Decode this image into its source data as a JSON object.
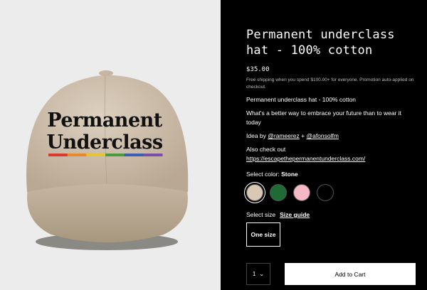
{
  "product": {
    "title_line1": "Permanent underclass",
    "title_line2": "hat - 100% cotton",
    "price": "$35.00",
    "shipping_note": "Free shipping when you spend $100.00+ for everyone. Promotion auto-applied on checkout.",
    "description_line": "Permanent underclass hat - 100% cotton",
    "tagline": "What's a better way to embrace your future than to wear it today",
    "idea_prefix": "Idea by ",
    "author1": "@rameerez",
    "idea_plus": " + ",
    "author2": "@afonsolfm",
    "also_check": "Also check out",
    "link": "https://escapethepermanentunderclass.com/"
  },
  "hat_text": {
    "line1": "Permanent",
    "line2": "Underclass"
  },
  "stripe_colors": [
    "#d83a2e",
    "#e98a2a",
    "#e6c42f",
    "#4a9d3e",
    "#3a5fb5",
    "#7b4ea8"
  ],
  "color_select": {
    "label": "Select color: ",
    "value": "Stone",
    "options": [
      {
        "name": "stone",
        "hex": "#d8c8b4",
        "selected": true
      },
      {
        "name": "green",
        "hex": "#1f6b35",
        "selected": false
      },
      {
        "name": "pink",
        "hex": "#f5b8c4",
        "selected": false
      },
      {
        "name": "black",
        "hex": "#000000",
        "selected": false
      }
    ]
  },
  "size_select": {
    "label": "Select size",
    "guide": "Size guide",
    "option": "One size"
  },
  "cart": {
    "qty": "1",
    "chevron": "⌄",
    "button": "Add to Cart"
  }
}
